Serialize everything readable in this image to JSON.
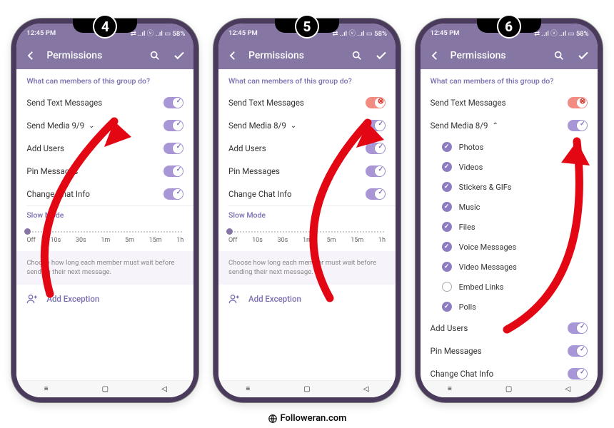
{
  "status": {
    "time": "12:45 PM",
    "icons": "◂ ▣ ▣",
    "right": "⇄ ..ıl ⓥ ..ıl ▭ 58%"
  },
  "header": {
    "title": "Permissions"
  },
  "labels": {
    "section": "What can members of this group do?",
    "slow": "Slow Mode",
    "note": "Choose how long each member must wait before sending their next message.",
    "add_exception": "Add Exception"
  },
  "perm": {
    "send_text": "Send Text Messages",
    "send_media_9": "Send Media 9/9",
    "send_media_8": "Send Media 8/9",
    "add_users": "Add Users",
    "pin": "Pin Messages",
    "change_info": "Change Chat Info"
  },
  "media": {
    "photos": "Photos",
    "videos": "Videos",
    "stickers": "Stickers & GIFs",
    "music": "Music",
    "files": "Files",
    "voice": "Voice Messages",
    "video_msg": "Video Messages",
    "embed": "Embed Links",
    "polls": "Polls"
  },
  "slider": {
    "ticks": [
      "Off",
      "10s",
      "30s",
      "1m",
      "5m",
      "15m",
      "1h"
    ]
  },
  "steps": {
    "s4": "4",
    "s5": "5",
    "s6": "6"
  },
  "footer": "Followeran.com"
}
